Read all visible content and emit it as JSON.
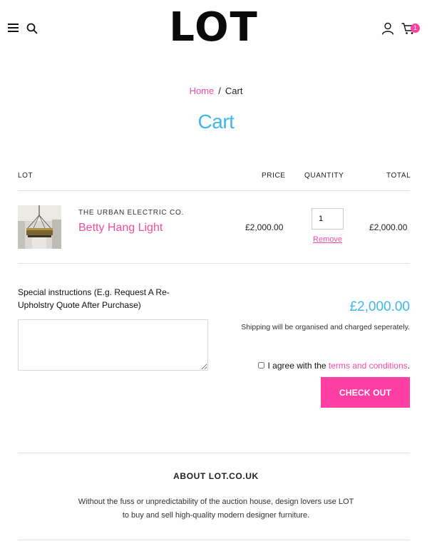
{
  "header": {
    "logo": "LOT",
    "cart_count": "1"
  },
  "breadcrumb": {
    "home": "Home",
    "separator": "/",
    "current": "Cart"
  },
  "page_title": "Cart",
  "table": {
    "headers": {
      "lot": "LOT",
      "price": "PRICE",
      "quantity": "QUANTITY",
      "total": "TOTAL"
    },
    "items": [
      {
        "vendor": "THE URBAN ELECTRIC CO.",
        "name": "Betty Hang Light",
        "price": "£2,000.00",
        "quantity": "1",
        "remove_label": "Remove",
        "total": "£2,000.00"
      }
    ]
  },
  "instructions": {
    "label": "Special instructions (E.g. Request A Re-Upholstry Quote After Purchase)",
    "value": ""
  },
  "summary": {
    "subtotal": "£2,000.00",
    "shipping_note": "Shipping will be organised and charged seperately.",
    "agree_prefix": "I agree with the",
    "terms_link": "terms and conditions",
    "agree_suffix": ".",
    "checkout_label": "CHECK OUT"
  },
  "about": {
    "title": "ABOUT LOT.CO.UK",
    "line1": "Without the fuss or unpredictability of the auction house, design lovers use LOT",
    "line2": "to buy and sell high-quality modern designer furniture."
  },
  "colors": {
    "accent_pink": "#ff3fa4",
    "link_pink": "#ee4ea4",
    "accent_blue": "#3fb7e9"
  },
  "icons": {
    "menu": "hamburger-menu-icon",
    "search": "search-icon",
    "account": "user-icon",
    "cart": "cart-icon"
  }
}
